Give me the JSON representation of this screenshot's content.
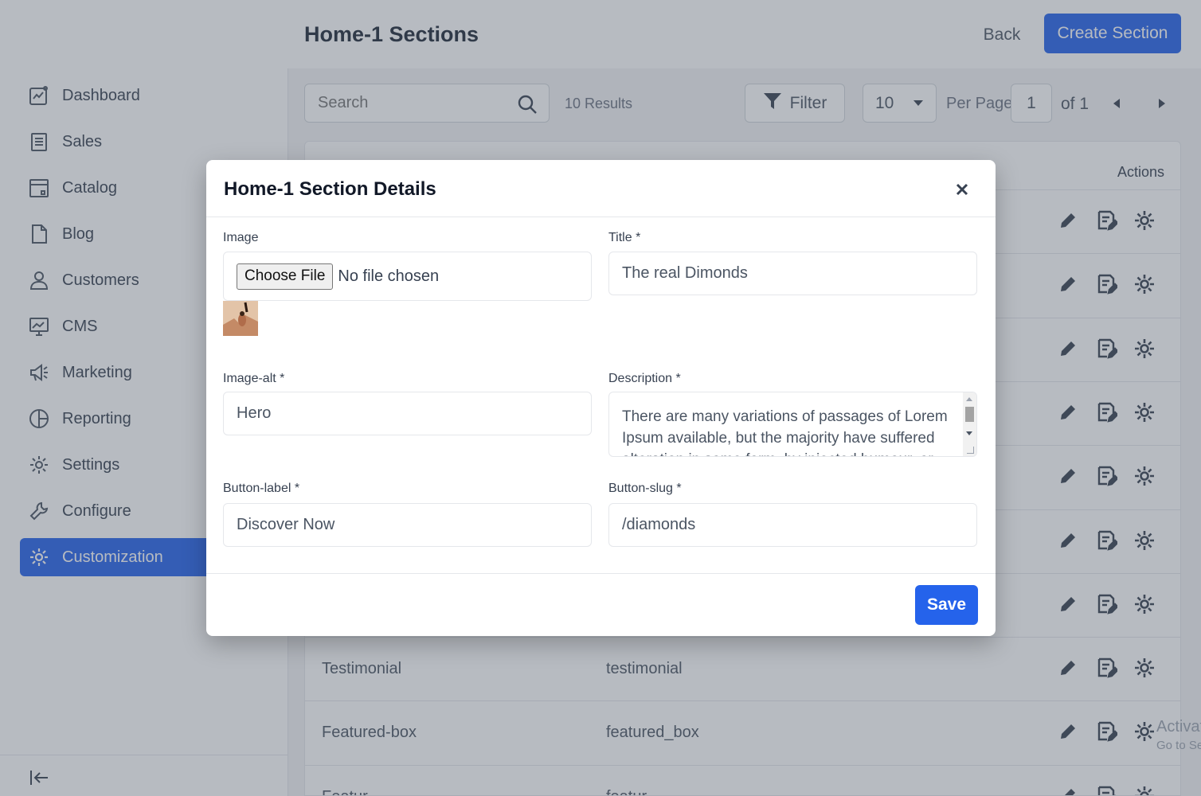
{
  "header": {
    "title": "Home-1 Sections",
    "back_label": "Back",
    "create_label": "Create Section"
  },
  "sidebar": {
    "items": [
      {
        "label": "Dashboard",
        "icon": "dashboard-icon"
      },
      {
        "label": "Sales",
        "icon": "sales-icon"
      },
      {
        "label": "Catalog",
        "icon": "catalog-icon"
      },
      {
        "label": "Blog",
        "icon": "blog-icon"
      },
      {
        "label": "Customers",
        "icon": "customers-icon"
      },
      {
        "label": "CMS",
        "icon": "cms-icon"
      },
      {
        "label": "Marketing",
        "icon": "marketing-icon"
      },
      {
        "label": "Reporting",
        "icon": "reporting-icon"
      },
      {
        "label": "Settings",
        "icon": "settings-icon"
      },
      {
        "label": "Configure",
        "icon": "wrench-icon"
      },
      {
        "label": "Customization",
        "icon": "gear-icon",
        "active": true
      }
    ]
  },
  "toolbar": {
    "search_placeholder": "Search",
    "results": "10 Results",
    "filter_label": "Filter",
    "per_page_value": "10",
    "per_page_label": "Per Page",
    "page_value": "1",
    "page_of": "of 1"
  },
  "table": {
    "actions_header": "Actions",
    "rows": [
      {
        "name": "",
        "slug": ""
      },
      {
        "name": "",
        "slug": ""
      },
      {
        "name": "",
        "slug": ""
      },
      {
        "name": "",
        "slug": ""
      },
      {
        "name": "",
        "slug": ""
      },
      {
        "name": "",
        "slug": ""
      },
      {
        "name": "",
        "slug": ""
      },
      {
        "name": "Testimonial",
        "slug": "testimonial"
      },
      {
        "name": "Featured-box",
        "slug": "featured_box"
      },
      {
        "name": "Featur...",
        "slug": "featur..."
      }
    ]
  },
  "watermark": {
    "line1": "Activate",
    "line2": "Go to Setti"
  },
  "modal": {
    "title": "Home-1 Section Details",
    "image_label": "Image",
    "choose_file_label": "Choose File",
    "no_file_text": "No file chosen",
    "title_label": "Title *",
    "title_value": "The real Dimonds",
    "image_alt_label": "Image-alt *",
    "image_alt_value": "Hero",
    "description_label": "Description *",
    "description_value": "There are many variations of passages of Lorem Ipsum available, but the majority have suffered alteration in some form, by injected humour, or",
    "button_label_label": "Button-label *",
    "button_label_value": "Discover Now",
    "button_slug_label": "Button-slug *",
    "button_slug_value": "/diamonds",
    "save_label": "Save"
  },
  "colors": {
    "primary": "#2563eb",
    "overlay": "rgba(75,85,99,0.4)"
  }
}
